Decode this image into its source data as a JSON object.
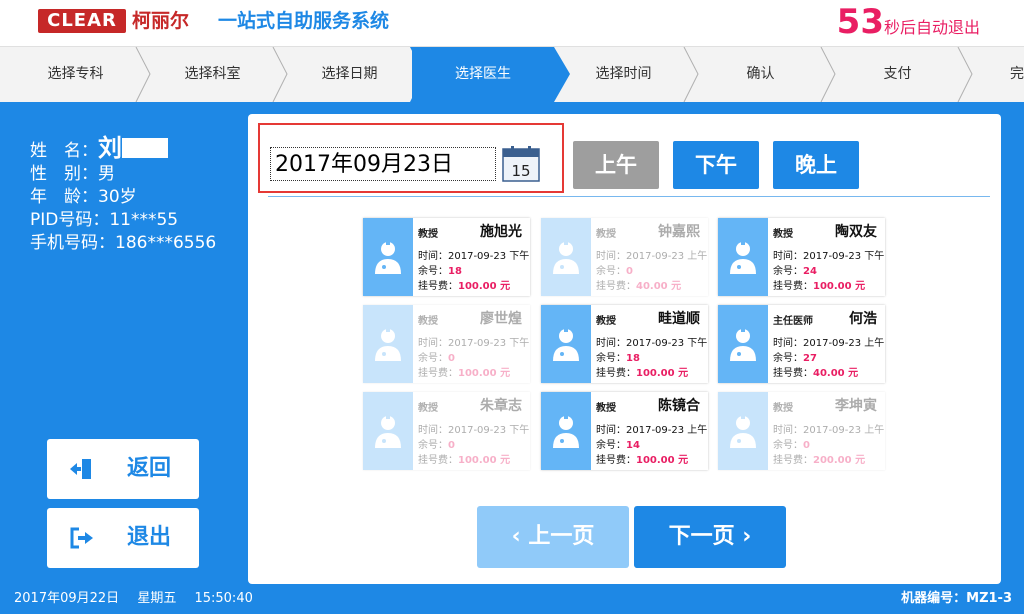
{
  "header": {
    "logo_text": "CLEAR",
    "brand": "柯丽尔",
    "system_title": "一站式自助服务系统",
    "countdown_value": "53",
    "countdown_text": "秒后自动退出"
  },
  "steps": [
    {
      "label": "选择专科",
      "active": false
    },
    {
      "label": "选择科室",
      "active": false
    },
    {
      "label": "选择日期",
      "active": false
    },
    {
      "label": "选择医生",
      "active": true
    },
    {
      "label": "选择时间",
      "active": false
    },
    {
      "label": "确认",
      "active": false
    },
    {
      "label": "支付",
      "active": false
    },
    {
      "label": "完",
      "active": false
    }
  ],
  "patient": {
    "name_label": "姓　名：",
    "name_value": "刘",
    "gender_label": "性　别：",
    "gender_value": "男",
    "age_label": "年　龄：",
    "age_value": "30岁",
    "pid_label": "PID号码：",
    "pid_value": "11***55",
    "phone_label": "手机号码：",
    "phone_value": "186***6556"
  },
  "buttons": {
    "back": "返回",
    "exit": "退出",
    "morning": "上午",
    "afternoon": "下午",
    "evening": "晚上",
    "prev_page": "上一页",
    "next_page": "下一页"
  },
  "date": {
    "value": "2017年09月23日",
    "calendar_day": "15"
  },
  "footer": {
    "date": "2017年09月22日",
    "weekday": "星期五",
    "time": "15:50:40",
    "machine": "机器编号：MZ1-3"
  },
  "labels": {
    "time": "时间：",
    "remaining": "余号：",
    "fee": "挂号费："
  },
  "doctors": [
    {
      "title": "教授",
      "name": "施旭光",
      "time": "2017-09-23 下午",
      "remaining": "18",
      "fee": "100.00 元",
      "available": true
    },
    {
      "title": "教授",
      "name": "钟嘉熙",
      "time": "2017-09-23 上午",
      "remaining": "0",
      "fee": "40.00 元",
      "available": false
    },
    {
      "title": "教授",
      "name": "陶双友",
      "time": "2017-09-23 下午",
      "remaining": "24",
      "fee": "100.00 元",
      "available": true
    },
    {
      "title": "教授",
      "name": "廖世煌",
      "time": "2017-09-23 下午",
      "remaining": "0",
      "fee": "100.00 元",
      "available": false
    },
    {
      "title": "教授",
      "name": "畦道顺",
      "time": "2017-09-23 下午",
      "remaining": "18",
      "fee": "100.00 元",
      "available": true
    },
    {
      "title": "主任医师",
      "name": "何浩",
      "time": "2017-09-23 上午",
      "remaining": "27",
      "fee": "40.00 元",
      "available": true
    },
    {
      "title": "教授",
      "name": "朱章志",
      "time": "2017-09-23 下午",
      "remaining": "0",
      "fee": "100.00 元",
      "available": false
    },
    {
      "title": "教授",
      "name": "陈镜合",
      "time": "2017-09-23 上午",
      "remaining": "14",
      "fee": "100.00 元",
      "available": true
    },
    {
      "title": "教授",
      "name": "李坤寅",
      "time": "2017-09-23 上午",
      "remaining": "0",
      "fee": "200.00 元",
      "available": false
    }
  ],
  "colors": {
    "accent": "#1e88e5",
    "brand_red": "#c62828",
    "highlight": "#e91e63",
    "disabled_button": "#9e9e9e"
  }
}
